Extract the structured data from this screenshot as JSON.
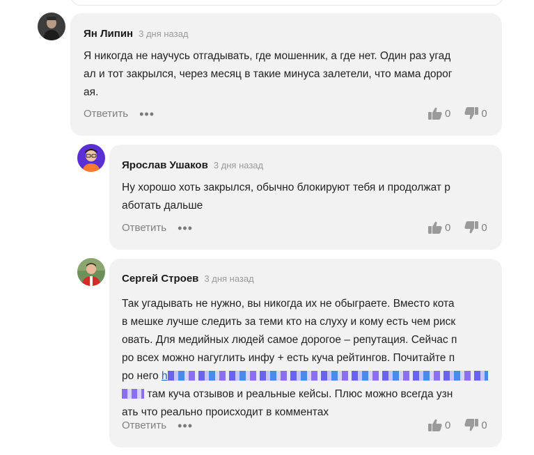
{
  "comments": [
    {
      "author": "Ян Липин",
      "time": "3 дня назад",
      "lines": [
        "Я никогда не научусь отгадывать, где мошенник, а где нет. Один раз угад",
        "ал и тот закрылся, через месяц в такие минуса залетели, что мама дорог",
        "ая."
      ],
      "reply_label": "Ответить",
      "more_label": "•••",
      "likes": "0",
      "dislikes": "0"
    },
    {
      "author": "Ярослав Ушаков",
      "time": "3 дня назад",
      "lines": [
        "Ну хорошо хоть закрылся, обычно блокируют тебя и продолжат р",
        "аботать дальше"
      ],
      "reply_label": "Ответить",
      "more_label": "•••",
      "likes": "0",
      "dislikes": "0"
    },
    {
      "author": "Сергей Строев",
      "time": "3 дня назад",
      "lines": [
        "Так угадывать не нужно, вы никогда их не обыграете. Вместо кота",
        "в мешке лучше следить за теми кто на слуху и кому есть чем риск",
        "овать. Для медийных людей самое дорогое – репутация. Сейчас п",
        "ро всех можно нагуглить инфу + есть куча рейтингов. Почитайте п",
        "ро него",
        "h",
        "там куча отзывов и реальные кейсы. Плюс можно всегда узн",
        "ать что реально происходит в комментах"
      ],
      "reply_label": "Ответить",
      "more_label": "•••",
      "likes": "0",
      "dislikes": "0"
    }
  ],
  "colors": {
    "card_bg": "#f2f2f2",
    "link": "#2a5bd7",
    "muted": "#808080"
  },
  "icons": [
    "thumbs-up-icon",
    "thumbs-down-icon",
    "more-dots-icon"
  ]
}
